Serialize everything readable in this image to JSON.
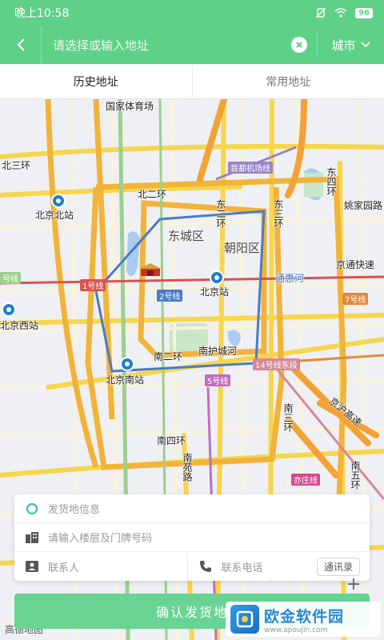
{
  "status_bar": {
    "time": "晚上10:58",
    "battery": "96"
  },
  "header": {
    "search_placeholder": "请选择或输入地址",
    "city_label": "城市"
  },
  "tabs": [
    {
      "label": "历史地址"
    },
    {
      "label": "常用地址"
    }
  ],
  "map": {
    "districts": [
      "东城区",
      "朝阳区"
    ],
    "roads": [
      "国家体育场",
      "北三环",
      "北二环",
      "东二环",
      "东三环",
      "东四环",
      "南二环",
      "南四环",
      "南三环",
      "南苑路",
      "南护城河",
      "通惠河",
      "京通快速",
      "姚家园路",
      "京沪高速",
      "南五环"
    ],
    "stations": [
      "北京北站",
      "北京站",
      "北京西站",
      "北京南站"
    ],
    "metro_lines": [
      "首都机场线",
      "1号线",
      "2号线",
      "5号线",
      "7号线",
      "14号线东段",
      "亦庄线",
      "号线"
    ],
    "brand": "高德地图"
  },
  "form": {
    "origin_placeholder": "发货地信息",
    "floor_placeholder": "请输入楼层及门牌号码",
    "contact_placeholder": "联系人",
    "phone_placeholder": "联系电话",
    "address_book_label": "通讯录"
  },
  "confirm_button": {
    "label": "确认发货地"
  },
  "watermark": {
    "main": "欧金软件园",
    "sub": "www.apoujin.com"
  }
}
